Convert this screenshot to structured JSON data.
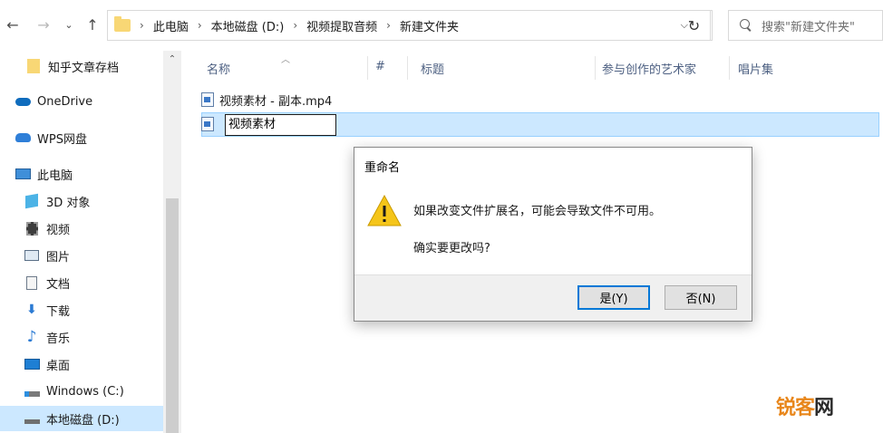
{
  "address_bar": {
    "crumbs": [
      "此电脑",
      "本地磁盘 (D:)",
      "视频提取音频",
      "新建文件夹"
    ]
  },
  "search": {
    "placeholder": "搜索\"新建文件夹\""
  },
  "sidebar": {
    "items": [
      {
        "label": "知乎文章存档",
        "icon": "folder-icon"
      },
      {
        "label": "OneDrive",
        "icon": "cloud-icon"
      },
      {
        "label": "WPS网盘",
        "icon": "wps-cloud-icon"
      },
      {
        "label": "此电脑",
        "icon": "computer-icon"
      },
      {
        "label": "3D 对象",
        "icon": "3d-objects-icon"
      },
      {
        "label": "视频",
        "icon": "video-icon"
      },
      {
        "label": "图片",
        "icon": "pictures-icon"
      },
      {
        "label": "文档",
        "icon": "documents-icon"
      },
      {
        "label": "下载",
        "icon": "download-icon"
      },
      {
        "label": "音乐",
        "icon": "music-icon"
      },
      {
        "label": "桌面",
        "icon": "desktop-icon"
      },
      {
        "label": "Windows (C:)",
        "icon": "drive-icon"
      },
      {
        "label": "本地磁盘 (D:)",
        "icon": "drive-icon"
      }
    ]
  },
  "columns": [
    "名称",
    "#",
    "标题",
    "参与创作的艺术家",
    "唱片集"
  ],
  "files": [
    {
      "name": "视频素材 - 副本.mp4"
    },
    {
      "name": "视频素材"
    }
  ],
  "dialog": {
    "title": "重命名",
    "message": "如果改变文件扩展名，可能会导致文件不可用。",
    "confirm": "确实要更改吗?",
    "yes": "是(Y)",
    "no": "否(N)"
  },
  "watermark": {
    "part1": "锐",
    "part2": "客",
    "part3": "网"
  }
}
